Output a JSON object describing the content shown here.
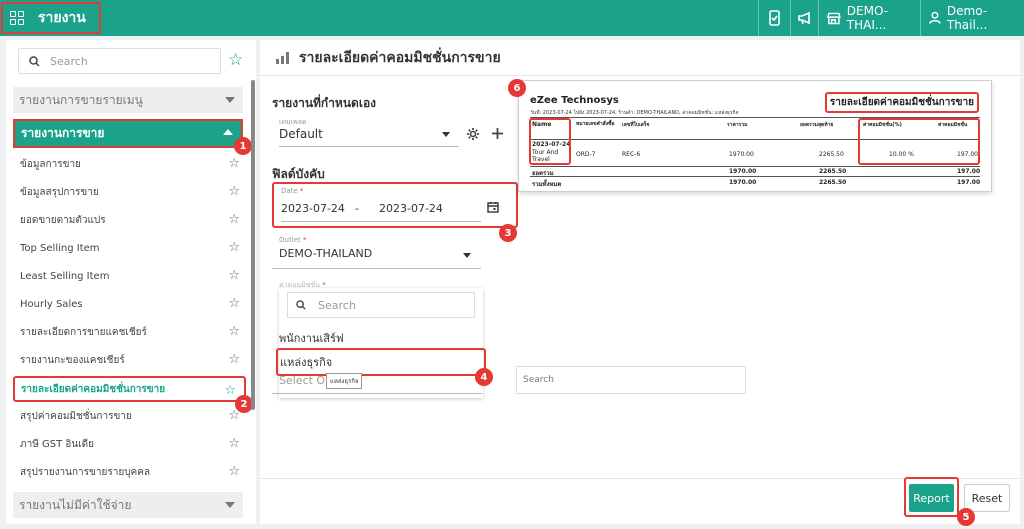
{
  "topbar": {
    "title": "รายงาน",
    "outlet": "DEMO-THAI...",
    "user": "Demo- Thail..."
  },
  "sidebar": {
    "search_placeholder": "Search",
    "groups": [
      {
        "label": "รายงานการขายรายเมนู"
      },
      {
        "label": "รายงานการขาย"
      },
      {
        "label": "รายงานไม่มีค่าใช้จ่าย"
      }
    ],
    "items": [
      {
        "label": "ข้อมูลการขาย"
      },
      {
        "label": "ข้อมูลสรุปการขาย"
      },
      {
        "label": "ยอดขายตามตัวแปร"
      },
      {
        "label": "Top Selling Item"
      },
      {
        "label": "Least Selling Item"
      },
      {
        "label": "Hourly Sales"
      },
      {
        "label": "รายละเอียดการขายแคชเชียร์"
      },
      {
        "label": "รายงานกะของแคชเชียร์"
      },
      {
        "label": "รายละเอียดค่าคอมมิชชั่นการขาย"
      },
      {
        "label": "สรุปค่าคอมมิชชั่นการขาย"
      },
      {
        "label": "ภาษี GST อินเดีย"
      },
      {
        "label": "สรุปรายงานการขายรายบุคคล"
      }
    ]
  },
  "main": {
    "title": "รายละเอียดค่าคอมมิชชั่นการขาย",
    "custom_report_label": "รายงานที่กำหนดเอง",
    "template_label": "เทมเพลต",
    "template_value": "Default",
    "required_fields_label": "ฟิลด์บังคับ",
    "date_label": "Date",
    "date_from": "2023-07-24",
    "date_sep": "-",
    "date_to": "2023-07-24",
    "outlet_label": "Outlet",
    "outlet_value": "DEMO-THAILAND",
    "commission_label": "ค่าคอมมิชชั่น",
    "dropdown_search_placeholder": "Search",
    "dropdown_options": [
      "พนักงานเสิร์ฟ",
      "แหล่งธุรกิจ"
    ],
    "select_placeholder": "Select On",
    "tooltip": "แหล่งธุรกิจ",
    "right_search_placeholder": "Search",
    "report_button": "Report",
    "reset_button": "Reset"
  },
  "preview": {
    "brand": "eZee Technosys",
    "title": "รายละเอียดค่าคอมมิชชั่นการขาย",
    "subtitle": "วันที่: 2023-07-24 ไปยัง 2023-07-24, ร้านค้า: DEMO-THAILAND, ค่าคอมมิชชั่น: แหล่งธุรกิจ",
    "headers": [
      "Name",
      "หมายเลขคำสั่งซื้อ",
      "เลขที่ใบเสร็จ",
      "ราคารวม",
      "ยอดรวมสุดท้าย",
      "ค่าคอมมิชชั่น(%)",
      "ค่าคอมมิชชั่น"
    ],
    "date_row": "2023-07-24",
    "row": [
      "Tour And Travel",
      "ORD-7",
      "REC-6",
      "1970.00",
      "2265.50",
      "10.00 %",
      "197.00"
    ],
    "subtotal_label": "ยอดรวม",
    "subtotal": [
      "1970.00",
      "2265.50",
      "197.00"
    ],
    "grand_label": "รวมทั้งหมด",
    "grand": [
      "1970.00",
      "2265.50",
      "197.00"
    ]
  },
  "badges": [
    "1",
    "2",
    "3",
    "4",
    "5",
    "6"
  ]
}
